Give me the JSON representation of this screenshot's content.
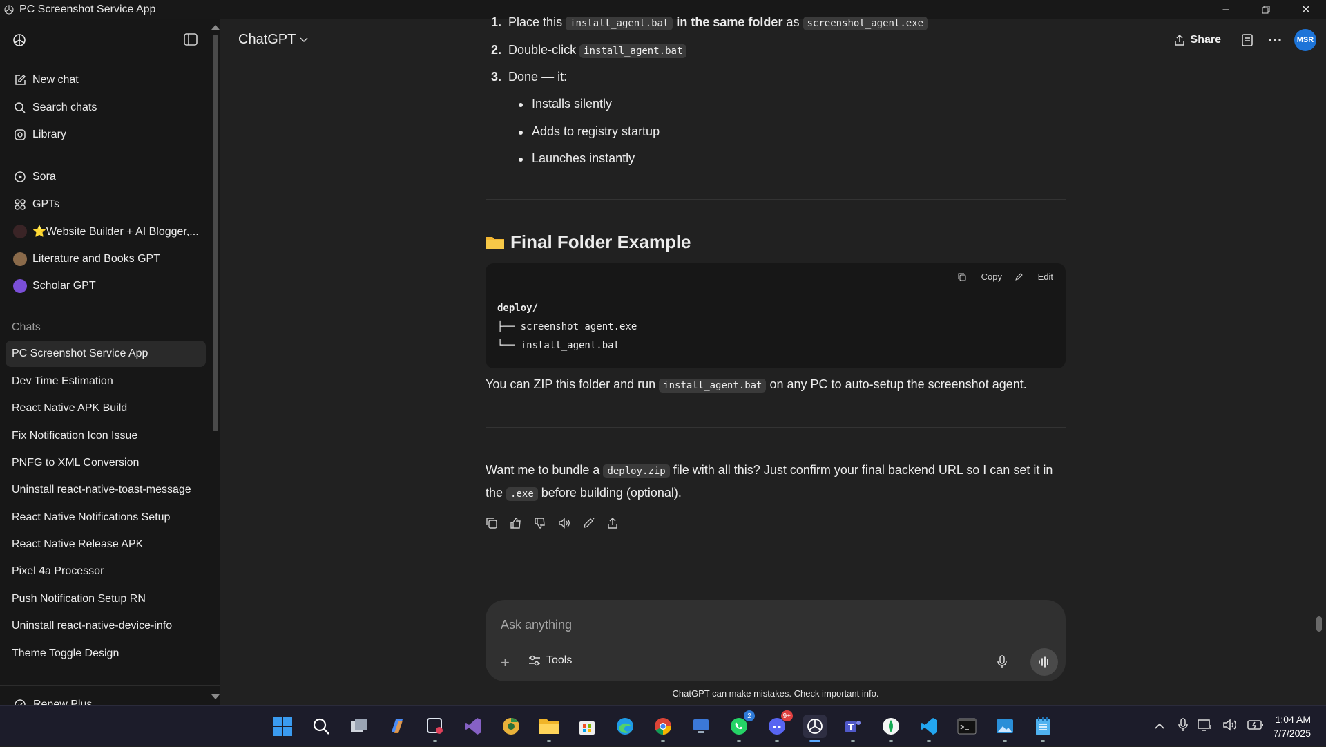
{
  "window": {
    "title": "PC Screenshot Service App"
  },
  "sidebar": {
    "nav": [
      {
        "label": "New chat",
        "icon": "new-chat-icon"
      },
      {
        "label": "Search chats",
        "icon": "search-icon"
      },
      {
        "label": "Library",
        "icon": "library-icon"
      }
    ],
    "gpts": [
      {
        "label": "Sora",
        "icon": "sora-icon"
      },
      {
        "label": "GPTs",
        "icon": "gpts-grid-icon"
      },
      {
        "label": "⭐Website Builder + AI Blogger,...",
        "icon": "gpt-avatar"
      },
      {
        "label": "Literature and Books GPT",
        "icon": "gpt-avatar"
      },
      {
        "label": "Scholar GPT",
        "icon": "gpt-avatar"
      }
    ],
    "chats_heading": "Chats",
    "chats": [
      "PC Screenshot Service App",
      "Dev Time Estimation",
      "React Native APK Build",
      "Fix Notification Icon Issue",
      "PNFG to XML Conversion",
      "Uninstall react-native-toast-message",
      "React Native Notifications Setup",
      "React Native Release APK",
      "Pixel 4a Processor",
      "Push Notification Setup RN",
      "Uninstall react-native-device-info",
      "Theme Toggle Design"
    ],
    "renew_label": "Renew Plus"
  },
  "header": {
    "model": "ChatGPT",
    "share_label": "Share",
    "avatar_initials": "MSR"
  },
  "message": {
    "steps": [
      {
        "num": "1.",
        "pre": "Place this",
        "code1": "install_agent.bat",
        "mid": "in the same folder",
        "post": "as",
        "code2": "screenshot_agent.exe"
      },
      {
        "num": "2.",
        "pre": "Double-click",
        "code1": "install_agent.bat"
      },
      {
        "num": "3.",
        "pre": "Done — it:"
      }
    ],
    "bullets": [
      "Installs silently",
      "Adds to registry startup",
      "Launches instantly"
    ],
    "section_heading": "Final Folder Example",
    "code_copy": "Copy",
    "code_edit": "Edit",
    "code_lines": [
      "deploy/",
      "├── screenshot_agent.exe",
      "└── install_agent.bat"
    ],
    "zip_pre": "You can ZIP this folder and run",
    "zip_code": "install_agent.bat",
    "zip_post": "on any PC to auto-setup the screenshot agent.",
    "q_pre": "Want me to bundle a",
    "q_code1": "deploy.zip",
    "q_mid": "file with all this? Just confirm your final backend URL so I can set it in the",
    "q_code2": ".exe",
    "q_post": "before building (optional)."
  },
  "composer": {
    "placeholder": "Ask anything",
    "tools_label": "Tools"
  },
  "disclaimer": "ChatGPT can make mistakes. Check important info.",
  "taskbar": {
    "time": "1:04 AM",
    "date": "7/7/2025",
    "whatsapp_badge": "2",
    "discord_badge": "9+"
  },
  "colors": {
    "accent": "#1d74d8",
    "background": "#212121",
    "sidebar": "#171717"
  }
}
